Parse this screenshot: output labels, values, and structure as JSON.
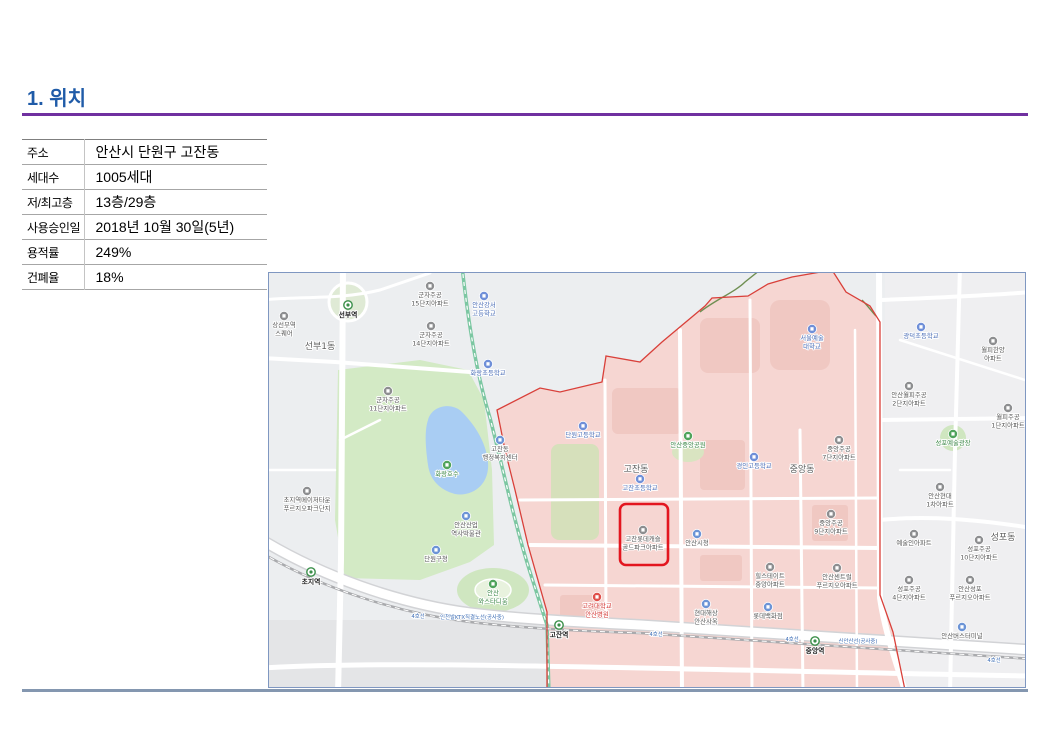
{
  "section": {
    "title": "1. 위치"
  },
  "info_table": {
    "rows": [
      {
        "label": "주소",
        "value": "안산시 단원구 고잔동"
      },
      {
        "label": "세대수",
        "value": "1005세대"
      },
      {
        "label": "저/최고층",
        "value": "13층/29층"
      },
      {
        "label": "사용승인일",
        "value": "2018년 10월 30일(5년)"
      },
      {
        "label": "용적률",
        "value": "249%"
      },
      {
        "label": "건폐율",
        "value": "18%"
      }
    ]
  },
  "colors": {
    "title": "#1f5ba8",
    "title_rule": "#7030a0",
    "bottom_rule": "#8497b0",
    "district_fill": "#f6d6d2",
    "district_border": "#d9403a",
    "highlight": "#e3161f"
  },
  "map": {
    "area_labels": [
      "선부1동",
      "고잔동",
      "중앙동",
      "성포동"
    ],
    "stations": [
      {
        "name": "선부역",
        "icon": "subway-station-icon"
      },
      {
        "name": "초지역",
        "icon": "subway-station-icon"
      },
      {
        "name": "고잔역",
        "icon": "subway-station-icon"
      },
      {
        "name": "중앙역",
        "icon": "subway-station-icon"
      }
    ],
    "rail_labels": [
      "4호선",
      "인천발KTX직결노선(공사중)",
      "4호선",
      "4호선",
      "신안산선(공사중)",
      "4호선"
    ],
    "places": [
      {
        "lines": [
          "상선부역",
          "스퀘어"
        ],
        "icon": "apartment-icon"
      },
      {
        "lines": [
          "군자주공",
          "15단지아파트"
        ],
        "icon": "apartment-icon"
      },
      {
        "lines": [
          "안산강서",
          "고등학교"
        ],
        "icon": "school-icon"
      },
      {
        "lines": [
          "군자주공",
          "14단지아파트"
        ],
        "icon": "apartment-icon"
      },
      {
        "lines": [
          "화랑초등학교"
        ],
        "icon": "school-icon"
      },
      {
        "lines": [
          "군자주공",
          "11단지아파트"
        ],
        "icon": "apartment-icon"
      },
      {
        "lines": [
          "서울예술",
          "대학교"
        ],
        "icon": "school-icon"
      },
      {
        "lines": [
          "광덕초등학교"
        ],
        "icon": "school-icon"
      },
      {
        "lines": [
          "월피한양",
          "아파트"
        ],
        "icon": "apartment-icon"
      },
      {
        "lines": [
          "안산월피주공",
          "2단지아파트"
        ],
        "icon": "apartment-icon"
      },
      {
        "lines": [
          "월피주공",
          "1단지아파트"
        ],
        "icon": "apartment-icon"
      },
      {
        "lines": [
          "단원고등학교"
        ],
        "icon": "school-icon"
      },
      {
        "lines": [
          "안산중앙공원"
        ],
        "icon": "park-icon"
      },
      {
        "lines": [
          "경인고등학교"
        ],
        "icon": "school-icon"
      },
      {
        "lines": [
          "중앙주공",
          "7단지아파트"
        ],
        "icon": "apartment-icon"
      },
      {
        "lines": [
          "성포예술광장"
        ],
        "icon": "park-icon"
      },
      {
        "lines": [
          "고잔동",
          "행정복지센터"
        ],
        "icon": "public-building-icon"
      },
      {
        "lines": [
          "화랑호수"
        ],
        "icon": "park-icon"
      },
      {
        "lines": [
          "고잔초등학교"
        ],
        "icon": "school-icon"
      },
      {
        "lines": [
          "초지역메이저타운",
          "푸르지오파크단지"
        ],
        "icon": "apartment-icon"
      },
      {
        "lines": [
          "안산현대",
          "1차아파트"
        ],
        "icon": "apartment-icon"
      },
      {
        "lines": [
          "중앙주공",
          "9단지아파트"
        ],
        "icon": "apartment-icon"
      },
      {
        "lines": [
          "안산산업",
          "역사박물관"
        ],
        "icon": "public-building-icon"
      },
      {
        "lines": [
          "고잔롯데캐슬",
          "골드파크아파트"
        ],
        "icon": "apartment-icon"
      },
      {
        "lines": [
          "안산시청"
        ],
        "icon": "public-building-icon"
      },
      {
        "lines": [
          "예술인아파트"
        ],
        "icon": "apartment-icon"
      },
      {
        "lines": [
          "성포주공",
          "10단지아파트"
        ],
        "icon": "apartment-icon"
      },
      {
        "lines": [
          "단원구청"
        ],
        "icon": "public-building-icon"
      },
      {
        "lines": [
          "안산",
          "와스타디움"
        ],
        "icon": "park-icon"
      },
      {
        "lines": [
          "힐스테이트",
          "중앙아파트"
        ],
        "icon": "apartment-icon"
      },
      {
        "lines": [
          "안산센트럴",
          "푸르지오아파트"
        ],
        "icon": "apartment-icon"
      },
      {
        "lines": [
          "성포주공",
          "4단지아파트"
        ],
        "icon": "apartment-icon"
      },
      {
        "lines": [
          "안산성포",
          "푸르지오아파트"
        ],
        "icon": "apartment-icon"
      },
      {
        "lines": [
          "고려대학교",
          "안산병원"
        ],
        "icon": "hospital-icon"
      },
      {
        "lines": [
          "현대해상",
          "안산사옥"
        ],
        "icon": "public-building-icon"
      },
      {
        "lines": [
          "롯데백화점"
        ],
        "icon": "public-building-icon"
      },
      {
        "lines": [
          "안산버스터미널"
        ],
        "icon": "public-building-icon"
      }
    ]
  }
}
